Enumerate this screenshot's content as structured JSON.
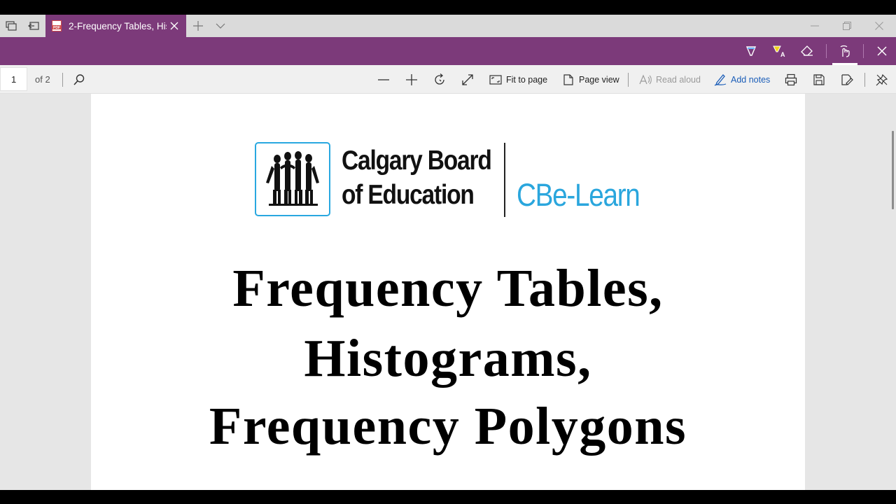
{
  "window": {
    "tab_title": "2-Frequency Tables, His",
    "tab_icon": "pdf-icon"
  },
  "toolbar": {
    "page_number": "1",
    "page_of": "of 2",
    "fit_to_page_label": "Fit to page",
    "page_view_label": "Page view",
    "read_aloud_label": "Read aloud",
    "add_notes_label": "Add notes"
  },
  "colors": {
    "accent_purple": "#7c3a7a",
    "logo_blue": "#2aa6dd",
    "link_blue": "#1a5db8"
  },
  "document": {
    "org_line1": "Calgary Board",
    "org_line2": "of Education",
    "brand": "CBe-Learn",
    "title_line1": "Frequency Tables,",
    "title_line2": "Histograms,",
    "title_line3": "Frequency Polygons"
  }
}
